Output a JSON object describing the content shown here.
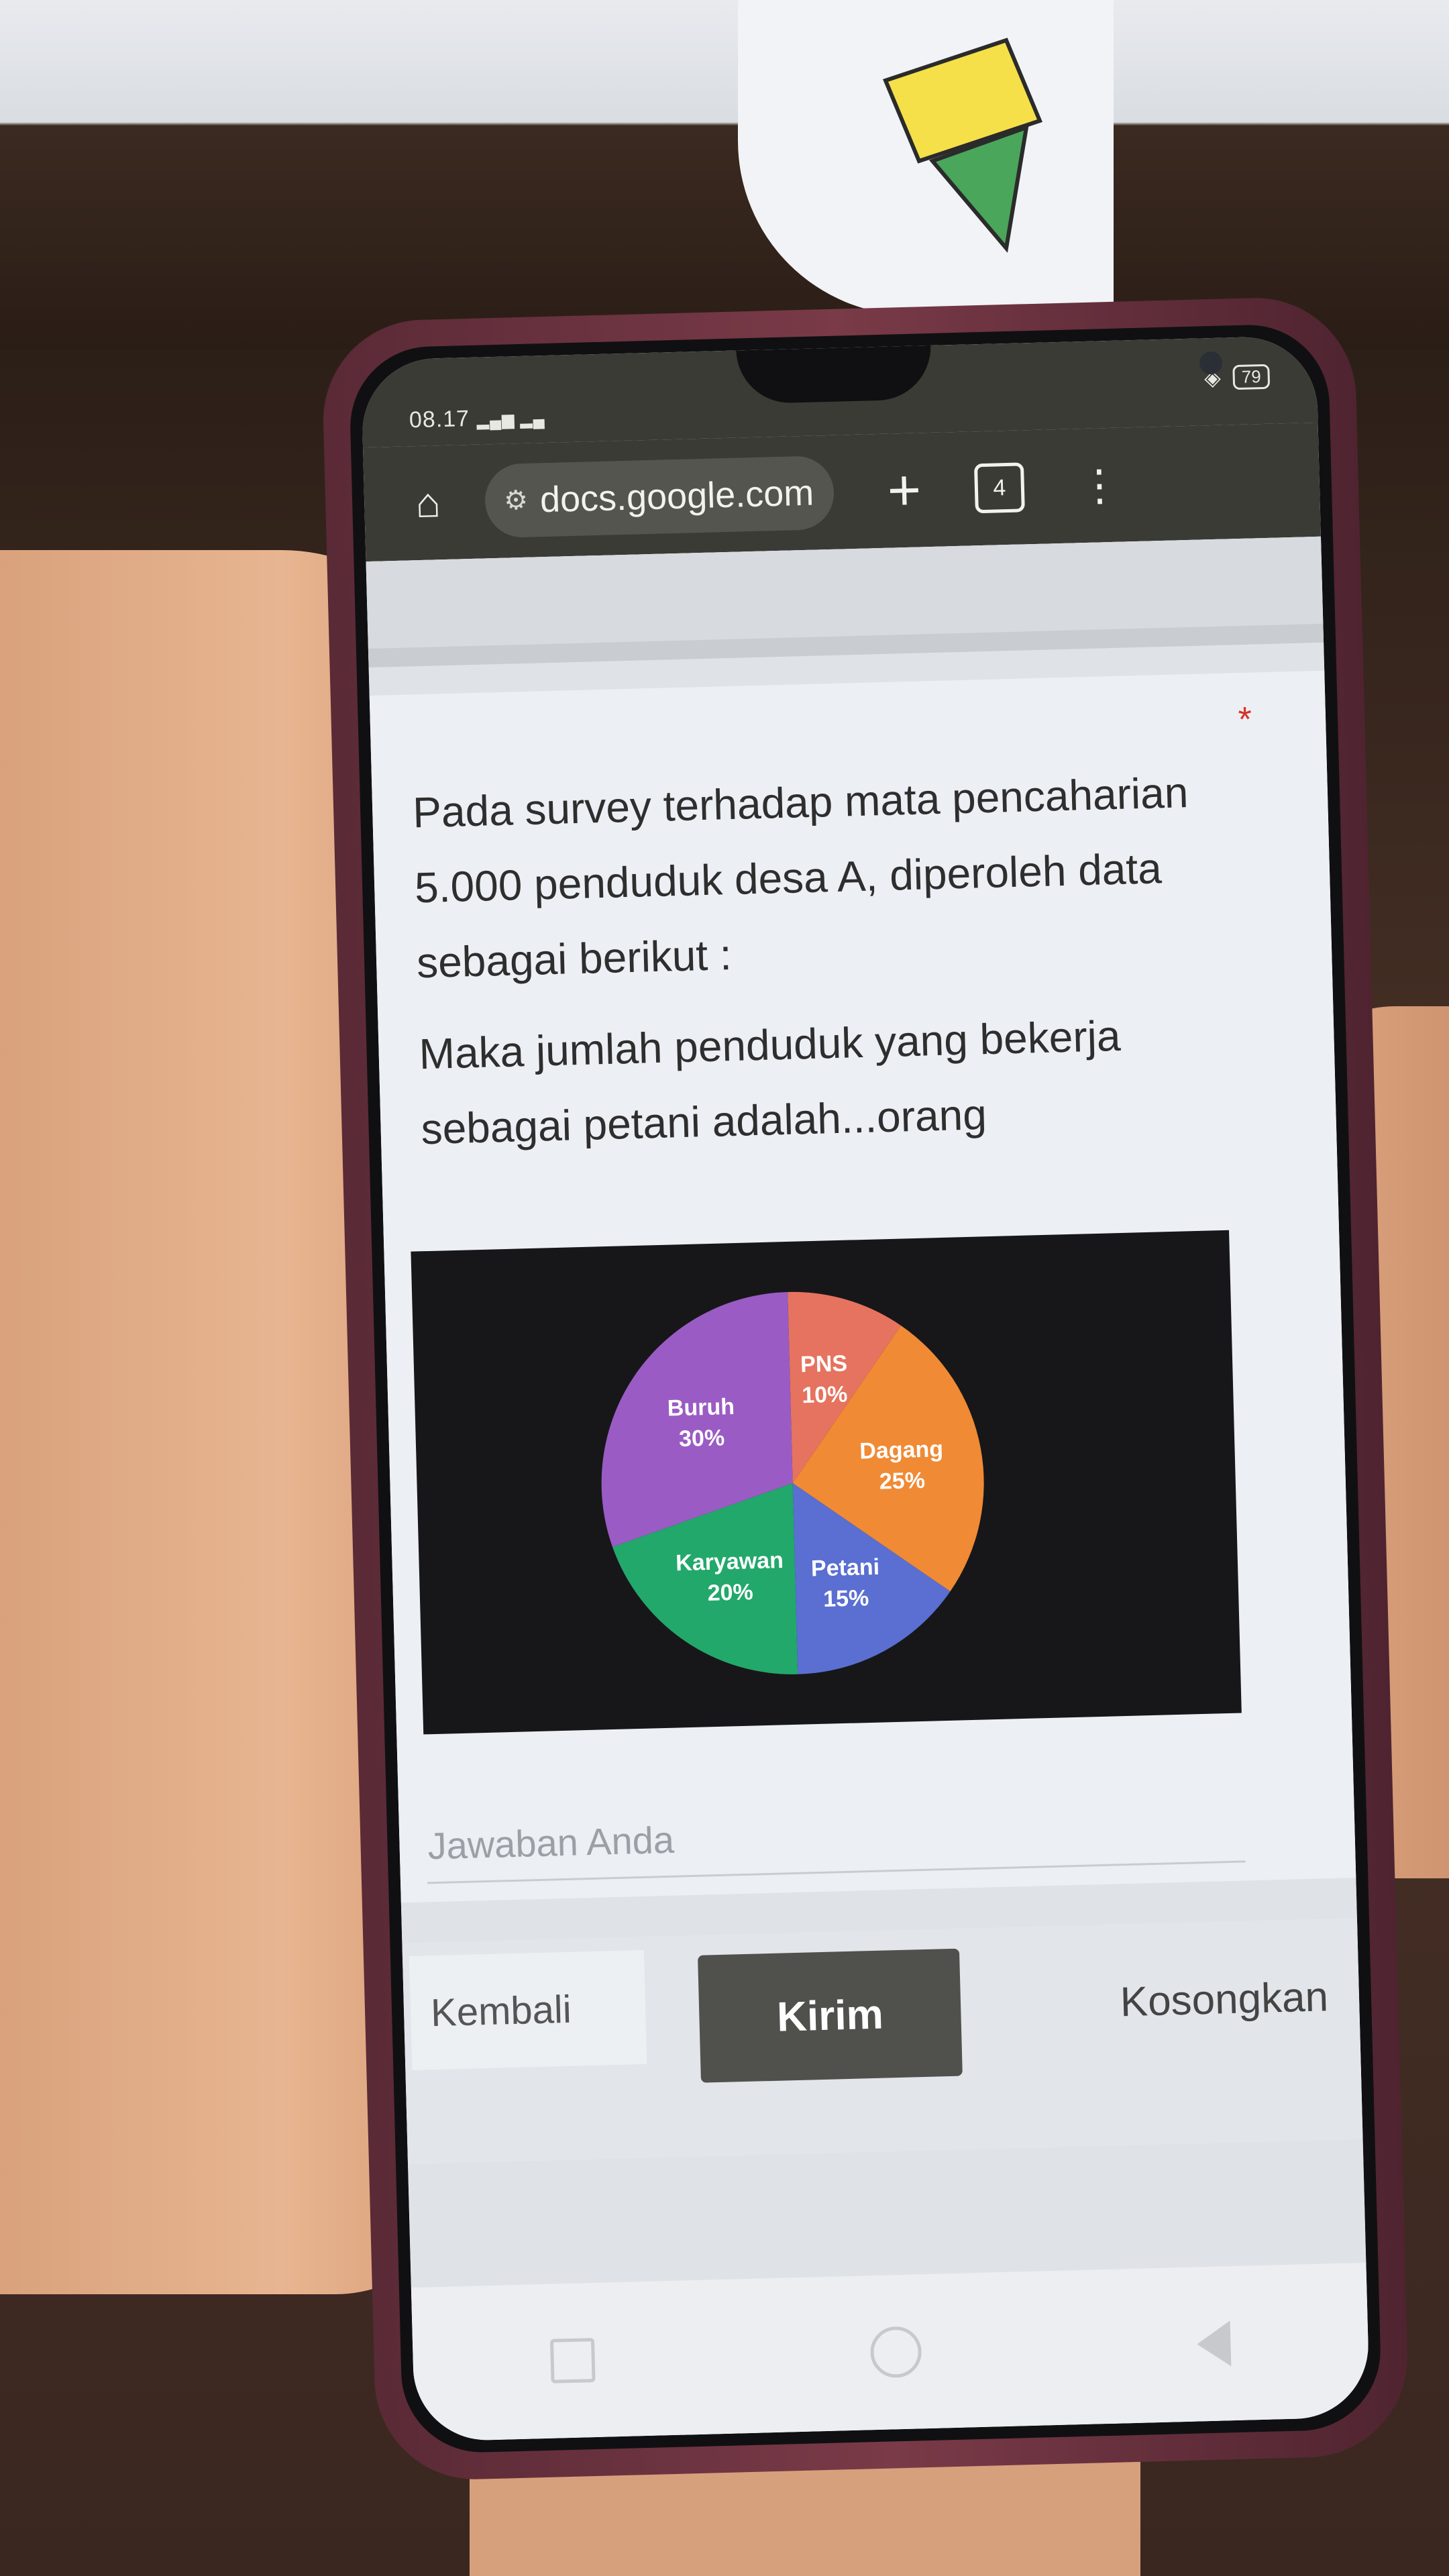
{
  "status_bar": {
    "time": "08.17",
    "signal": "▂▄▆ ▂▄",
    "battery": "79"
  },
  "browser": {
    "url": "docs.google.com",
    "tab_count": "4"
  },
  "form": {
    "required_marker": "*",
    "question_line1": "Pada survey terhadap mata pencaharian 5.000 penduduk desa A, diperoleh data sebagai berikut :",
    "question_line2": "Maka jumlah penduduk yang bekerja sebagai petani adalah...orang",
    "answer_placeholder": "Jawaban Anda",
    "back_label": "Kembali",
    "submit_label": "Kirim",
    "clear_label": "Kosongkan"
  },
  "icons": {
    "home": "home-icon",
    "site_settings": "tune-icon",
    "new_tab": "plus-icon",
    "tabs": "tab-switcher-icon",
    "menu": "more-vert-icon"
  },
  "chart_data": {
    "type": "pie",
    "categories": [
      "PNS",
      "Dagang",
      "Petani",
      "Karyawan",
      "Buruh"
    ],
    "values": [
      10,
      25,
      15,
      20,
      30
    ],
    "labels": [
      "10%",
      "25%",
      "15%",
      "20%",
      "30%"
    ],
    "colors": [
      "#e5735f",
      "#f08a34",
      "#5a6fd1",
      "#22a86b",
      "#9a5cc4"
    ]
  }
}
